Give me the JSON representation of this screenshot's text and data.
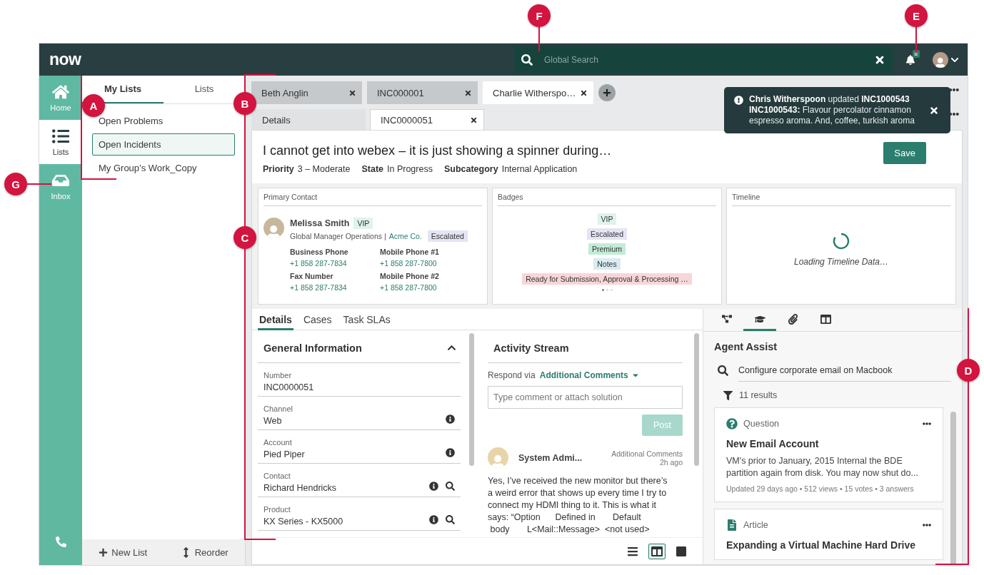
{
  "topbar": {
    "logo": "now",
    "search_placeholder": "Global Search",
    "notification_count": "8"
  },
  "nav": [
    {
      "label": "Home",
      "selected": false
    },
    {
      "label": "Lists",
      "selected": true
    },
    {
      "label": "Inbox",
      "selected": false
    }
  ],
  "lists_panel": {
    "tabs": [
      {
        "label": "My Lists",
        "selected": true
      },
      {
        "label": "Lists",
        "selected": false
      }
    ],
    "items": [
      {
        "label": "Open Problems",
        "selected": false
      },
      {
        "label": "Open Incidents",
        "selected": true
      },
      {
        "label": "My Group’s Work_Copy",
        "selected": false
      }
    ],
    "actions": [
      {
        "label": "New List"
      },
      {
        "label": "Reorder"
      }
    ]
  },
  "record_tabs": [
    {
      "label": "Beth Anglin",
      "selected": false
    },
    {
      "label": "INC000001",
      "selected": false
    },
    {
      "label": "Charlie Witherspo…",
      "selected": true
    }
  ],
  "sub_tabs": [
    {
      "label": "Details",
      "selected": false
    },
    {
      "label": "INC0000051",
      "selected": true
    }
  ],
  "notification": {
    "headline": "**Chris Witherspoon** updated **INC1000543**",
    "body": "**INC1000543:** Flavour percolator cinnamon espresso aroma. And, coffee, turkish aroma"
  },
  "record": {
    "title": "I cannot get into webex – it is just showing a spinner during…",
    "fields": [
      {
        "label": "Priority",
        "value": "3 – Moderate"
      },
      {
        "label": "State",
        "value": "In Progress"
      },
      {
        "label": "Subcategory",
        "value": "Internal Application"
      }
    ],
    "save": "Save"
  },
  "contact_card": {
    "title": "Primary Contact",
    "name": "Melissa Smith",
    "name_badge": {
      "label": "VIP",
      "color": "#dff3ea"
    },
    "role": "Global Manager Operations |",
    "company": "Acme Co.",
    "status_badge": {
      "label": "Escalated",
      "color": "#e4e4f4"
    },
    "phones": [
      {
        "label": "Business Phone",
        "value": "+1 858 287-7834"
      },
      {
        "label": "Mobile Phone #1",
        "value": "+1 858 287-7800"
      },
      {
        "label": "Fax Number",
        "value": "+1 858 287-7834"
      },
      {
        "label": "Mobile Phone #2",
        "value": "+1 858 287-7800"
      }
    ]
  },
  "badges_card": {
    "title": "Badges",
    "items": [
      {
        "label": "VIP",
        "color": "#dff3ea"
      },
      {
        "label": "Escalated",
        "color": "#e4e4f4"
      },
      {
        "label": "Premium",
        "color": "#c4ebd7"
      },
      {
        "label": "Notes",
        "color": "#d8ecf1"
      },
      {
        "label": "Ready for Submission, Approval & Processing …",
        "color": "#f8d6d8"
      }
    ],
    "pages": [
      {
        "selected": true
      },
      {
        "selected": false
      },
      {
        "selected": false
      }
    ]
  },
  "timeline_card": {
    "title": "Timeline",
    "message": "Loading Timeline Data…"
  },
  "detail_tabs": [
    {
      "label": "Details",
      "selected": true
    },
    {
      "label": "Cases",
      "selected": false
    },
    {
      "label": "Task SLAs",
      "selected": false
    }
  ],
  "general_info": {
    "title": "General Information",
    "expanded": true,
    "fields": [
      {
        "label": "Number",
        "value": "INC0000051",
        "kind": "plain"
      },
      {
        "label": "Channel",
        "value": "Web",
        "kind": "info"
      },
      {
        "label": "Account",
        "value": "Pied Piper",
        "kind": "info"
      },
      {
        "label": "Contact",
        "value": "Richard Hendricks",
        "kind": "lookup"
      },
      {
        "label": "Product",
        "value": "KX Series - KX5000",
        "kind": "lookup"
      }
    ]
  },
  "activity": {
    "title": "Activity Stream",
    "respond_label": "Respond via",
    "respond_value": "Additional Comments",
    "placeholder": "Type comment or attach solution",
    "post": "Post",
    "post_disabled": true,
    "entries": [
      {
        "author": "System Admi...",
        "type": "Additional Comments",
        "time": "2h ago",
        "text": "Yes, I’ve received the new monitor but there’s\na weird error that shows up every time I try to\nconnect my HDMI thing to it. This is what it\nsays: “Option      Defined in       Default\n body       L<Mail::Message>  <not used>"
      }
    ]
  },
  "view_modes": [
    {
      "selected": false
    },
    {
      "selected": true
    },
    {
      "selected": false
    }
  ],
  "agent_assist": {
    "tabs": [
      {
        "selected": false
      },
      {
        "selected": true
      },
      {
        "selected": false
      },
      {
        "selected": false
      }
    ],
    "title": "Agent Assist",
    "query": "Configure corporate email on Macbook",
    "results": "11 results",
    "items": [
      {
        "kind": "question",
        "type_label": "Question",
        "title": "New Email Account",
        "snippet": "VM's prior to January, 2015 Internal the BDE partition again from disk. You may now shut do...",
        "meta": "Updated 29 days ago • 512 views • 15 votes • 3 answers"
      },
      {
        "kind": "article",
        "type_label": "Article",
        "title": "Expanding a Virtual Machine Hard Drive"
      }
    ]
  },
  "callouts": [
    {
      "label": "F"
    },
    {
      "label": "E"
    },
    {
      "label": "A"
    },
    {
      "label": "B"
    },
    {
      "label": "G"
    },
    {
      "label": "C"
    },
    {
      "label": "D"
    }
  ]
}
